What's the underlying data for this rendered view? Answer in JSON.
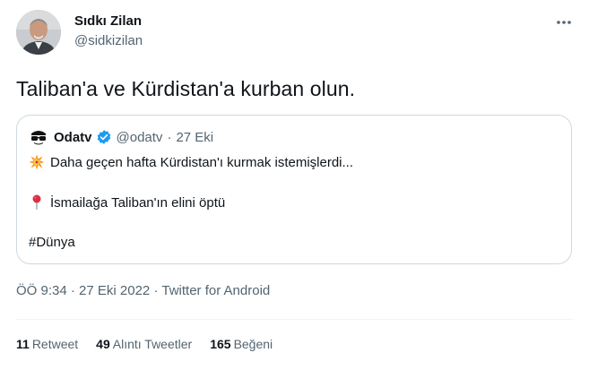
{
  "author": {
    "name": "Sıdkı Zilan",
    "handle": "@sidkizilan"
  },
  "tweet": {
    "text": "Taliban'a ve Kürdistan'a kurban olun."
  },
  "quoted": {
    "name": "Odatv",
    "handle": "@odatv",
    "separator": "·",
    "date": "27 Eki",
    "line1": "Daha geçen hafta Kürdistan'ı kurmak istemişlerdi...",
    "line1_icon": "collision-emoji-icon",
    "line2": "İsmailağa Taliban'ın elini öptü",
    "line2_icon": "round-pushpin-emoji-icon",
    "line3": "#Dünya"
  },
  "meta": {
    "time": "ÖÖ 9:34",
    "separator1": "·",
    "date": "27 Eki 2022",
    "separator2": "·",
    "source": "Twitter for Android"
  },
  "stats": {
    "retweets_count": "11",
    "retweets_label": "Retweet",
    "quotes_count": "49",
    "quotes_label": "Alıntı Tweetler",
    "likes_count": "165",
    "likes_label": "Beğeni"
  },
  "colors": {
    "text": "#0f1419",
    "secondary": "#536471",
    "border": "#cfd9de",
    "verified": "#1d9bf0"
  }
}
